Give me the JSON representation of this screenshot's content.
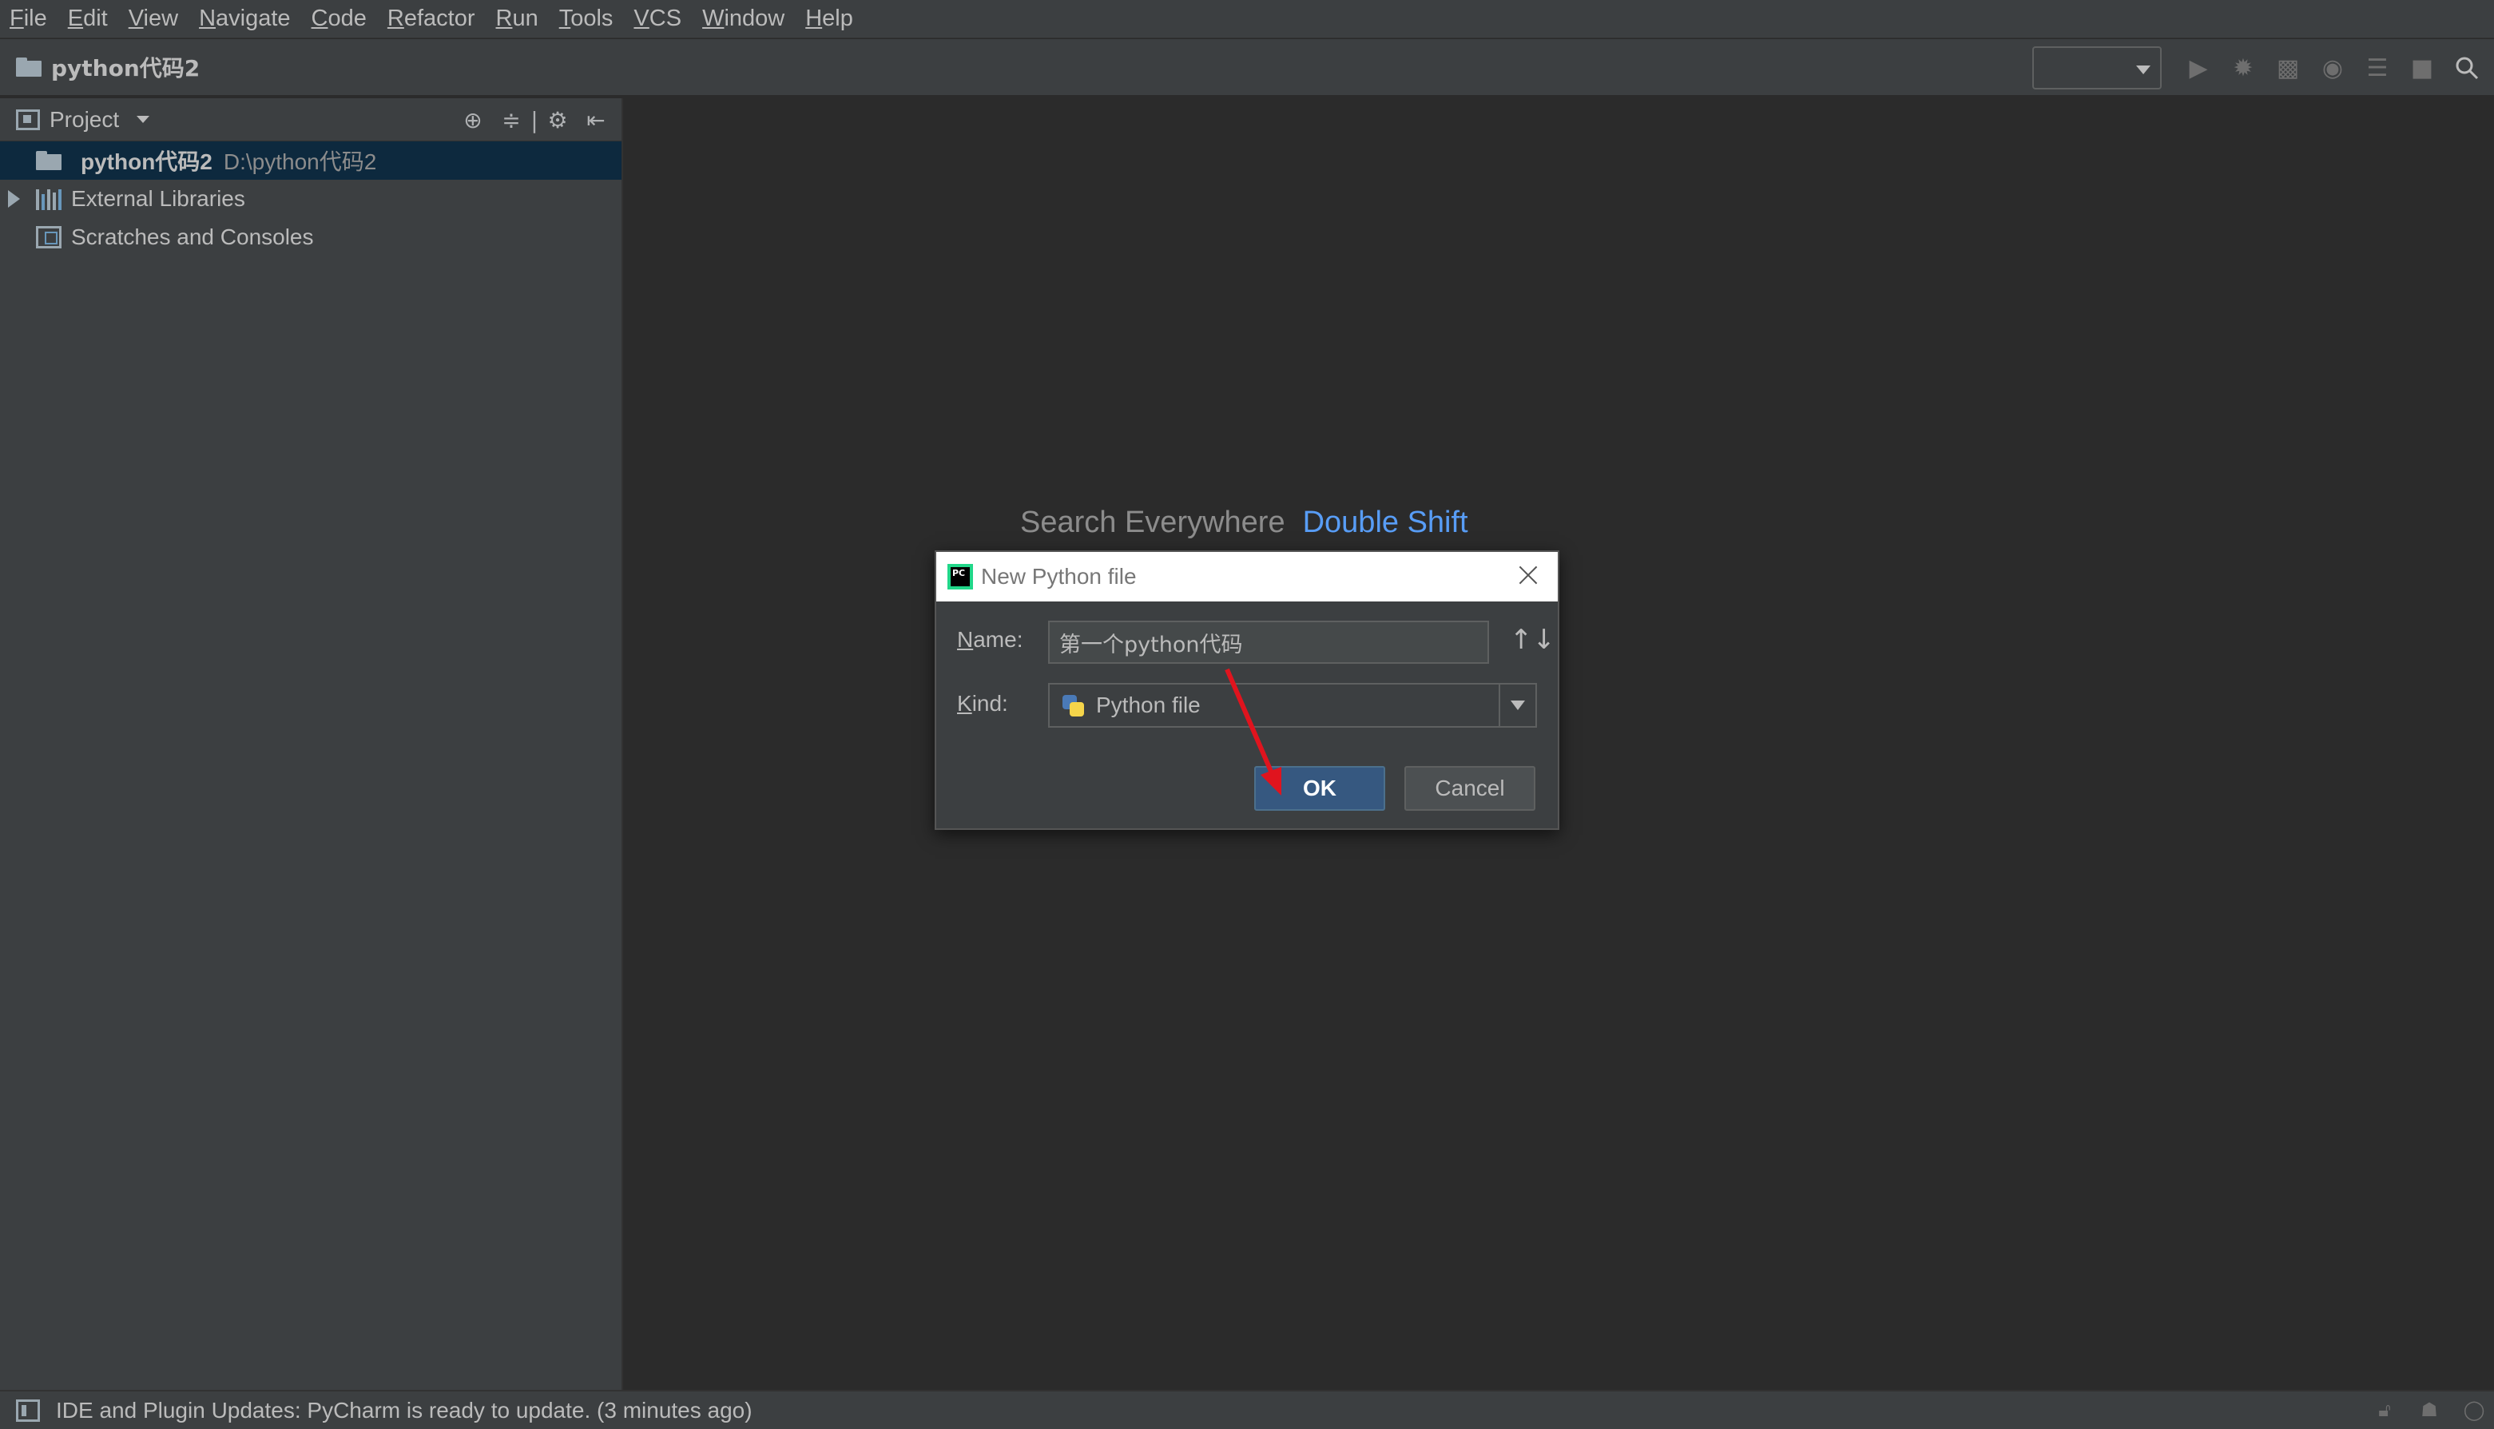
{
  "menubar": {
    "items": [
      {
        "mnemonic": "F",
        "rest": "ile"
      },
      {
        "mnemonic": "E",
        "rest": "dit"
      },
      {
        "mnemonic": "V",
        "rest": "iew"
      },
      {
        "mnemonic": "N",
        "rest": "avigate"
      },
      {
        "mnemonic": "C",
        "rest": "ode"
      },
      {
        "mnemonic": "R",
        "rest": "efactor"
      },
      {
        "mnemonic": "R",
        "rest": "un"
      },
      {
        "mnemonic": "T",
        "rest": "ools"
      },
      {
        "mnemonic": "V",
        "rest": "CS"
      },
      {
        "mnemonic": "W",
        "rest": "indow"
      },
      {
        "mnemonic": "H",
        "rest": "elp"
      }
    ]
  },
  "navbar": {
    "breadcrumb": "python代码2",
    "run_config_value": ""
  },
  "project_panel": {
    "title": "Project",
    "tree": [
      {
        "label": "python代码2",
        "path": "D:\\python代码2",
        "icon": "folder-icon",
        "selected": true
      },
      {
        "label": "External Libraries",
        "icon": "library-icon"
      },
      {
        "label": "Scratches and Consoles",
        "icon": "scratches-icon"
      }
    ]
  },
  "editor": {
    "hint_text": "Search Everywhere",
    "hint_shortcut": "Double Shift"
  },
  "dialog": {
    "title": "New Python file",
    "name_label_mnemonic": "N",
    "name_label_rest": "ame:",
    "name_value": "第一个python代码",
    "kind_label_mnemonic": "K",
    "kind_label_rest": "ind:",
    "kind_value": "Python file",
    "ok_label": "OK",
    "cancel_label": "Cancel"
  },
  "annotation": {
    "arrow_color": "#e0141e"
  },
  "statusbar": {
    "message": "IDE and Plugin Updates: PyCharm is ready to update. (3 minutes ago)"
  },
  "colors": {
    "background": "#2b2b2b",
    "panel": "#3c3f41",
    "selection": "#0d293e",
    "accent_link": "#589df6",
    "ok_button": "#365880"
  }
}
